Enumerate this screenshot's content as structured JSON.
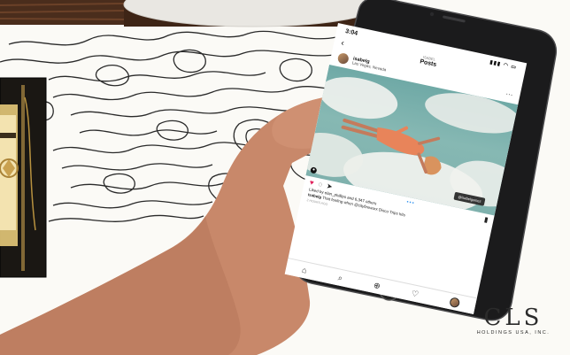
{
  "instagram": {
    "time": "3:04",
    "signal": "▮▮▮ ◠ ▭",
    "account_label": "ISABEL",
    "title": "Posts",
    "username": "isabelg",
    "location": "Las Vegas, Nevada",
    "likes_text": "Liked by elan_phillips and 6,347 others",
    "caption_user": "isabelg",
    "caption_text": "That feeling when @cityfireworx Disco Trips hits",
    "time_ago": "2 hours ago",
    "photo_tag": "@isabelgomez"
  },
  "logo": {
    "mark": "CLS",
    "subtitle": "HOLDINGS USA, INC."
  },
  "icons": [
    "heart-icon",
    "comment-icon",
    "share-icon",
    "bookmark-icon",
    "home-icon",
    "search-icon",
    "add-icon",
    "like-icon",
    "profile-icon"
  ],
  "colors": {
    "background": "#fbfaf6",
    "topo_lines": "#2a2a2a",
    "sky": "#7fb1ad",
    "outfit": "#e8845a",
    "skin": "#c8886a",
    "phone_body": "#1b1b1c",
    "like_red": "#e0245e"
  }
}
